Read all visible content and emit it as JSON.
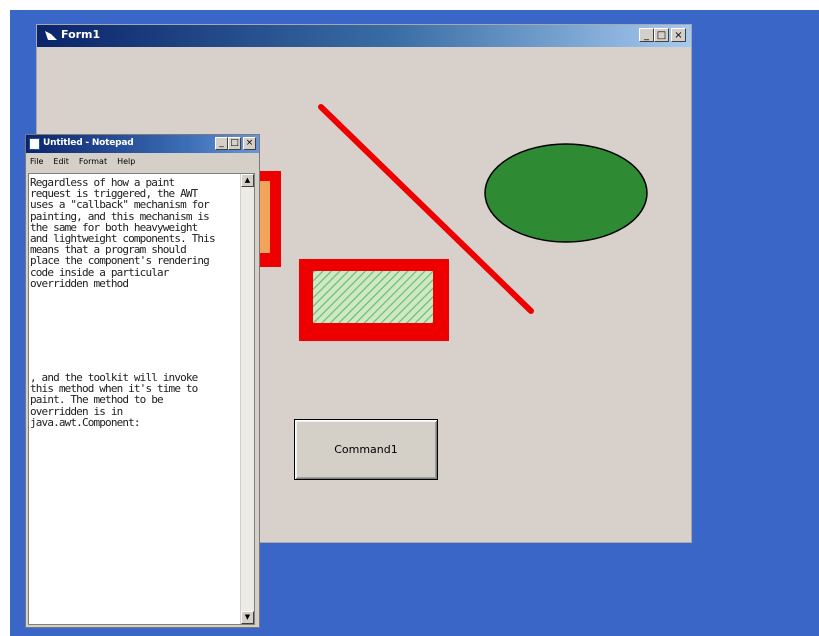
{
  "form_window": {
    "title": "Form1",
    "command_button_label": "Command1",
    "caption_buttons": {
      "minimize": "_",
      "maximize": "□",
      "close": "×"
    }
  },
  "notepad": {
    "title": "Untitled - Notepad",
    "menu": [
      "File",
      "Edit",
      "Format",
      "Help"
    ],
    "caption_buttons": {
      "minimize": "_",
      "maximize": "□",
      "close": "×"
    },
    "text_part1": "Regardless of how a paint\nrequest is triggered, the AWT\nuses a \"callback\" mechanism for\npainting, and this mechanism is\nthe same for both heavyweight\nand lightweight components. This\nmeans that a program should\nplace the component's rendering\ncode inside a particular\noverridden method",
    "text_part2": ", and the toolkit will invoke\nthis method when it's time to\npaint. The method to be\noverridden is in\njava.awt.Component:",
    "scroll_up": "▲",
    "scroll_down": "▼"
  },
  "colors": {
    "desktop": "#3a66c8",
    "form_background": "#d7d0cb",
    "shape_red": "#ee0000",
    "ellipse_fill": "#2e8b33",
    "hatch_fill": "#9fd29a"
  }
}
